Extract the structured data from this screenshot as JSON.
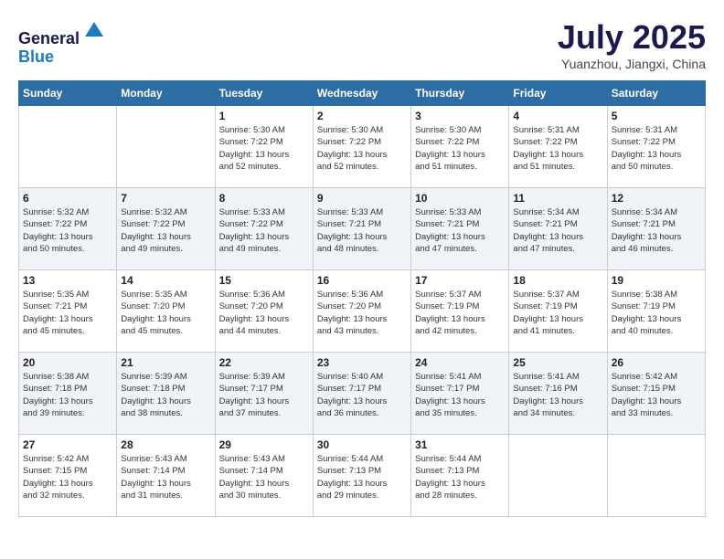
{
  "header": {
    "logo_line1": "General",
    "logo_line2": "Blue",
    "month": "July 2025",
    "location": "Yuanzhou, Jiangxi, China"
  },
  "weekdays": [
    "Sunday",
    "Monday",
    "Tuesday",
    "Wednesday",
    "Thursday",
    "Friday",
    "Saturday"
  ],
  "weeks": [
    [
      {
        "day": "",
        "info": ""
      },
      {
        "day": "",
        "info": ""
      },
      {
        "day": "1",
        "info": "Sunrise: 5:30 AM\nSunset: 7:22 PM\nDaylight: 13 hours\nand 52 minutes."
      },
      {
        "day": "2",
        "info": "Sunrise: 5:30 AM\nSunset: 7:22 PM\nDaylight: 13 hours\nand 52 minutes."
      },
      {
        "day": "3",
        "info": "Sunrise: 5:30 AM\nSunset: 7:22 PM\nDaylight: 13 hours\nand 51 minutes."
      },
      {
        "day": "4",
        "info": "Sunrise: 5:31 AM\nSunset: 7:22 PM\nDaylight: 13 hours\nand 51 minutes."
      },
      {
        "day": "5",
        "info": "Sunrise: 5:31 AM\nSunset: 7:22 PM\nDaylight: 13 hours\nand 50 minutes."
      }
    ],
    [
      {
        "day": "6",
        "info": "Sunrise: 5:32 AM\nSunset: 7:22 PM\nDaylight: 13 hours\nand 50 minutes."
      },
      {
        "day": "7",
        "info": "Sunrise: 5:32 AM\nSunset: 7:22 PM\nDaylight: 13 hours\nand 49 minutes."
      },
      {
        "day": "8",
        "info": "Sunrise: 5:33 AM\nSunset: 7:22 PM\nDaylight: 13 hours\nand 49 minutes."
      },
      {
        "day": "9",
        "info": "Sunrise: 5:33 AM\nSunset: 7:21 PM\nDaylight: 13 hours\nand 48 minutes."
      },
      {
        "day": "10",
        "info": "Sunrise: 5:33 AM\nSunset: 7:21 PM\nDaylight: 13 hours\nand 47 minutes."
      },
      {
        "day": "11",
        "info": "Sunrise: 5:34 AM\nSunset: 7:21 PM\nDaylight: 13 hours\nand 47 minutes."
      },
      {
        "day": "12",
        "info": "Sunrise: 5:34 AM\nSunset: 7:21 PM\nDaylight: 13 hours\nand 46 minutes."
      }
    ],
    [
      {
        "day": "13",
        "info": "Sunrise: 5:35 AM\nSunset: 7:21 PM\nDaylight: 13 hours\nand 45 minutes."
      },
      {
        "day": "14",
        "info": "Sunrise: 5:35 AM\nSunset: 7:20 PM\nDaylight: 13 hours\nand 45 minutes."
      },
      {
        "day": "15",
        "info": "Sunrise: 5:36 AM\nSunset: 7:20 PM\nDaylight: 13 hours\nand 44 minutes."
      },
      {
        "day": "16",
        "info": "Sunrise: 5:36 AM\nSunset: 7:20 PM\nDaylight: 13 hours\nand 43 minutes."
      },
      {
        "day": "17",
        "info": "Sunrise: 5:37 AM\nSunset: 7:19 PM\nDaylight: 13 hours\nand 42 minutes."
      },
      {
        "day": "18",
        "info": "Sunrise: 5:37 AM\nSunset: 7:19 PM\nDaylight: 13 hours\nand 41 minutes."
      },
      {
        "day": "19",
        "info": "Sunrise: 5:38 AM\nSunset: 7:19 PM\nDaylight: 13 hours\nand 40 minutes."
      }
    ],
    [
      {
        "day": "20",
        "info": "Sunrise: 5:38 AM\nSunset: 7:18 PM\nDaylight: 13 hours\nand 39 minutes."
      },
      {
        "day": "21",
        "info": "Sunrise: 5:39 AM\nSunset: 7:18 PM\nDaylight: 13 hours\nand 38 minutes."
      },
      {
        "day": "22",
        "info": "Sunrise: 5:39 AM\nSunset: 7:17 PM\nDaylight: 13 hours\nand 37 minutes."
      },
      {
        "day": "23",
        "info": "Sunrise: 5:40 AM\nSunset: 7:17 PM\nDaylight: 13 hours\nand 36 minutes."
      },
      {
        "day": "24",
        "info": "Sunrise: 5:41 AM\nSunset: 7:17 PM\nDaylight: 13 hours\nand 35 minutes."
      },
      {
        "day": "25",
        "info": "Sunrise: 5:41 AM\nSunset: 7:16 PM\nDaylight: 13 hours\nand 34 minutes."
      },
      {
        "day": "26",
        "info": "Sunrise: 5:42 AM\nSunset: 7:15 PM\nDaylight: 13 hours\nand 33 minutes."
      }
    ],
    [
      {
        "day": "27",
        "info": "Sunrise: 5:42 AM\nSunset: 7:15 PM\nDaylight: 13 hours\nand 32 minutes."
      },
      {
        "day": "28",
        "info": "Sunrise: 5:43 AM\nSunset: 7:14 PM\nDaylight: 13 hours\nand 31 minutes."
      },
      {
        "day": "29",
        "info": "Sunrise: 5:43 AM\nSunset: 7:14 PM\nDaylight: 13 hours\nand 30 minutes."
      },
      {
        "day": "30",
        "info": "Sunrise: 5:44 AM\nSunset: 7:13 PM\nDaylight: 13 hours\nand 29 minutes."
      },
      {
        "day": "31",
        "info": "Sunrise: 5:44 AM\nSunset: 7:13 PM\nDaylight: 13 hours\nand 28 minutes."
      },
      {
        "day": "",
        "info": ""
      },
      {
        "day": "",
        "info": ""
      }
    ]
  ]
}
